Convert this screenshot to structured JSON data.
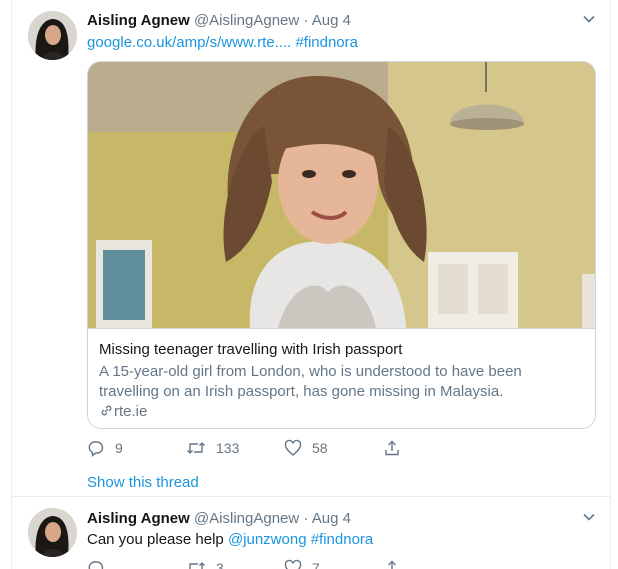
{
  "tweet1": {
    "name": "Aisling Agnew",
    "handle": "@AislingAgnew",
    "sep": "·",
    "date": "Aug 4",
    "url_text": "google.co.uk/amp/s/www.rte....",
    "hashtag": "#findnora",
    "card": {
      "title": "Missing teenager travelling with Irish passport",
      "description": "A 15-year-old girl from London, who is understood to have been travelling on an Irish passport, has gone missing in Malaysia.",
      "domain": "rte.ie"
    },
    "actions": {
      "replies": "9",
      "retweets": "133",
      "likes": "58"
    },
    "show_thread": "Show this thread"
  },
  "tweet2": {
    "name": "Aisling Agnew",
    "handle": "@AislingAgnew",
    "sep": "·",
    "date": "Aug 4",
    "text": "Can you please help",
    "mention": "@junzwong",
    "hashtag": "#findnora",
    "actions": {
      "retweets": "3",
      "likes": "7"
    }
  },
  "colors": {
    "link": "#1b95e0",
    "muted": "#657786",
    "text": "#14171a",
    "border": "#ccd6dd"
  },
  "icons": [
    "chevron-down-icon",
    "reply-icon",
    "retweet-icon",
    "like-icon",
    "share-icon",
    "link-icon"
  ]
}
